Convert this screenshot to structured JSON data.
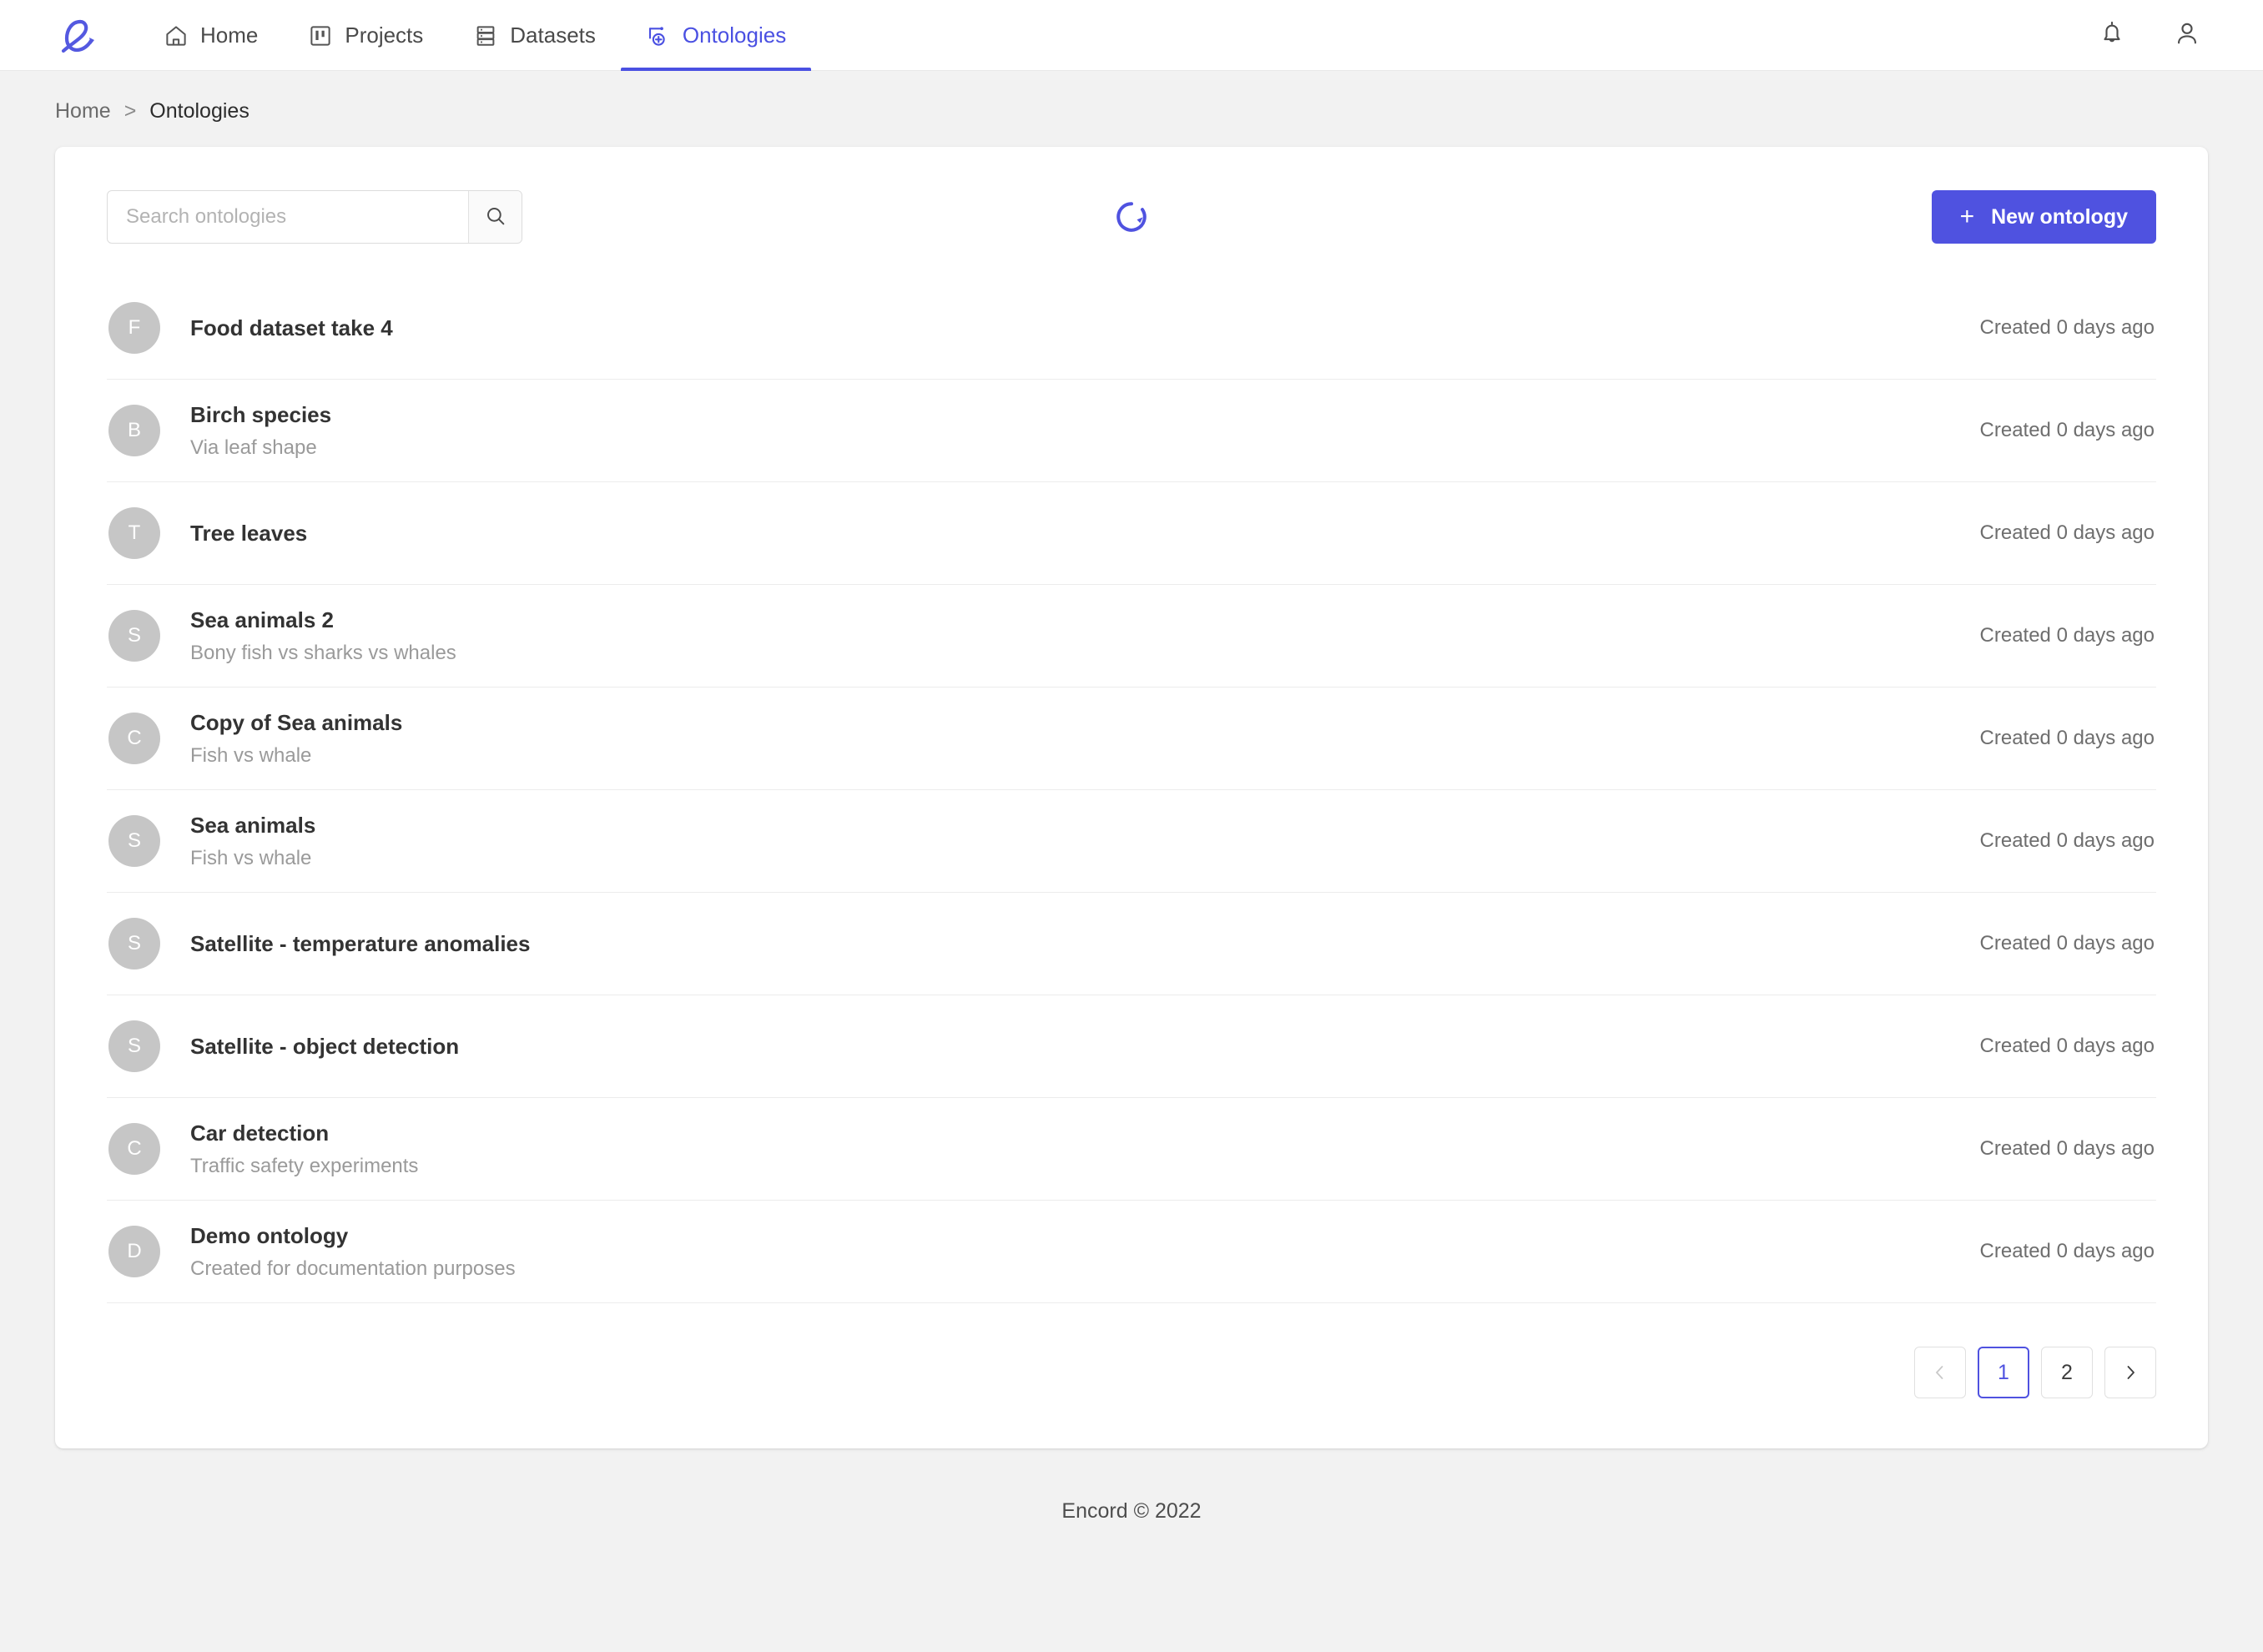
{
  "navbar": {
    "logo_name": "encord-logo",
    "items": [
      {
        "label": "Home",
        "icon": "home-icon",
        "active": false
      },
      {
        "label": "Projects",
        "icon": "projects-icon",
        "active": false
      },
      {
        "label": "Datasets",
        "icon": "datasets-icon",
        "active": false
      },
      {
        "label": "Ontologies",
        "icon": "ontologies-icon",
        "active": true
      }
    ],
    "notifications_icon": "bell-icon",
    "account_icon": "user-icon"
  },
  "breadcrumb": {
    "home": "Home",
    "separator": ">",
    "current": "Ontologies"
  },
  "toolbar": {
    "search_placeholder": "Search ontologies",
    "search_value": "",
    "search_icon": "search-icon",
    "loading": true,
    "new_ontology_label": "New ontology",
    "new_ontology_plus": "+"
  },
  "list": {
    "rows": [
      {
        "initial": "F",
        "title": "Food dataset take 4",
        "subtitle": "",
        "meta": "Created 0 days ago"
      },
      {
        "initial": "B",
        "title": "Birch species",
        "subtitle": "Via leaf shape",
        "meta": "Created 0 days ago"
      },
      {
        "initial": "T",
        "title": "Tree leaves",
        "subtitle": "",
        "meta": "Created 0 days ago"
      },
      {
        "initial": "S",
        "title": "Sea animals 2",
        "subtitle": "Bony fish vs sharks vs whales",
        "meta": "Created 0 days ago"
      },
      {
        "initial": "C",
        "title": "Copy of Sea animals",
        "subtitle": "Fish vs whale",
        "meta": "Created 0 days ago"
      },
      {
        "initial": "S",
        "title": "Sea animals",
        "subtitle": "Fish vs whale",
        "meta": "Created 0 days ago"
      },
      {
        "initial": "S",
        "title": "Satellite - temperature anomalies",
        "subtitle": "",
        "meta": "Created 0 days ago"
      },
      {
        "initial": "S",
        "title": "Satellite - object detection",
        "subtitle": "",
        "meta": "Created 0 days ago"
      },
      {
        "initial": "C",
        "title": "Car detection",
        "subtitle": "Traffic safety experiments",
        "meta": "Created 0 days ago"
      },
      {
        "initial": "D",
        "title": "Demo ontology",
        "subtitle": "Created for documentation purposes",
        "meta": "Created 0 days ago"
      }
    ]
  },
  "pagination": {
    "prev_label": "‹",
    "next_label": "›",
    "pages": [
      "1",
      "2"
    ],
    "current_page": "1"
  },
  "footer": {
    "text": "Encord © 2022"
  },
  "colors": {
    "accent": "#4f52e0",
    "page_bg": "#f2f2f2",
    "card_bg": "#ffffff",
    "avatar_bg": "#c6c6c6",
    "muted_text": "#9a9a9a"
  }
}
